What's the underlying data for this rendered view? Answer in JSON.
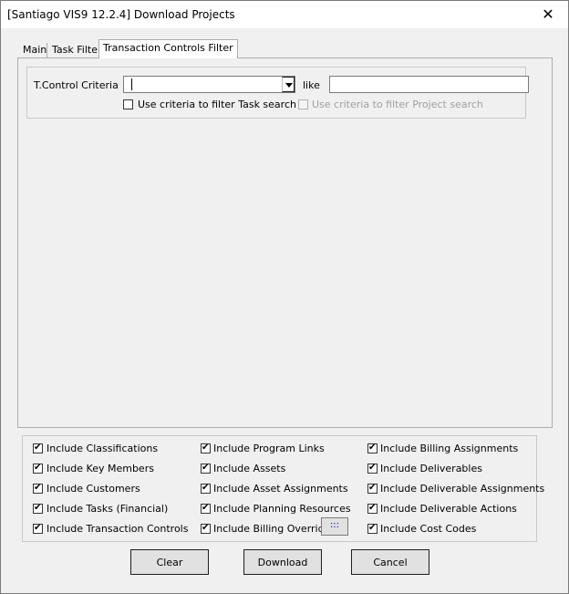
{
  "window": {
    "title": "[Santiago VIS9 12.2.4] Download Projects",
    "close_glyph": "✕"
  },
  "tabs": [
    {
      "label": "Main"
    },
    {
      "label": "Task Filter"
    },
    {
      "label": "Transaction Controls Filter"
    }
  ],
  "filter": {
    "criteria_label": "T.Control Criteria",
    "criteria_value": "",
    "like_label": "like",
    "like_value": "",
    "task_search_label": "Use criteria to filter Task search",
    "project_search_label": "Use criteria to filter Project search"
  },
  "options": {
    "col1": [
      {
        "label": "Include Classifications",
        "checked": true
      },
      {
        "label": "Include Key Members",
        "checked": true
      },
      {
        "label": "Include Customers",
        "checked": true
      },
      {
        "label": "Include Tasks (Financial)",
        "checked": true
      },
      {
        "label": "Include Transaction Controls",
        "checked": true
      }
    ],
    "col2": [
      {
        "label": "Include Program Links",
        "checked": true
      },
      {
        "label": "Include Assets",
        "checked": true
      },
      {
        "label": "Include Asset Assignments",
        "checked": true
      },
      {
        "label": "Include Planning Resources",
        "checked": true
      },
      {
        "label": "Include Billing Overrides",
        "checked": true
      }
    ],
    "col3": [
      {
        "label": "Include Billing Assignments",
        "checked": true
      },
      {
        "label": "Include Deliverables",
        "checked": true
      },
      {
        "label": "Include Deliverable Assignments",
        "checked": true
      },
      {
        "label": "Include Deliverable Actions",
        "checked": true
      },
      {
        "label": "Include Cost Codes",
        "checked": true
      }
    ],
    "more_button_label": ":::"
  },
  "buttons": {
    "clear": "Clear",
    "download": "Download",
    "cancel": "Cancel"
  }
}
